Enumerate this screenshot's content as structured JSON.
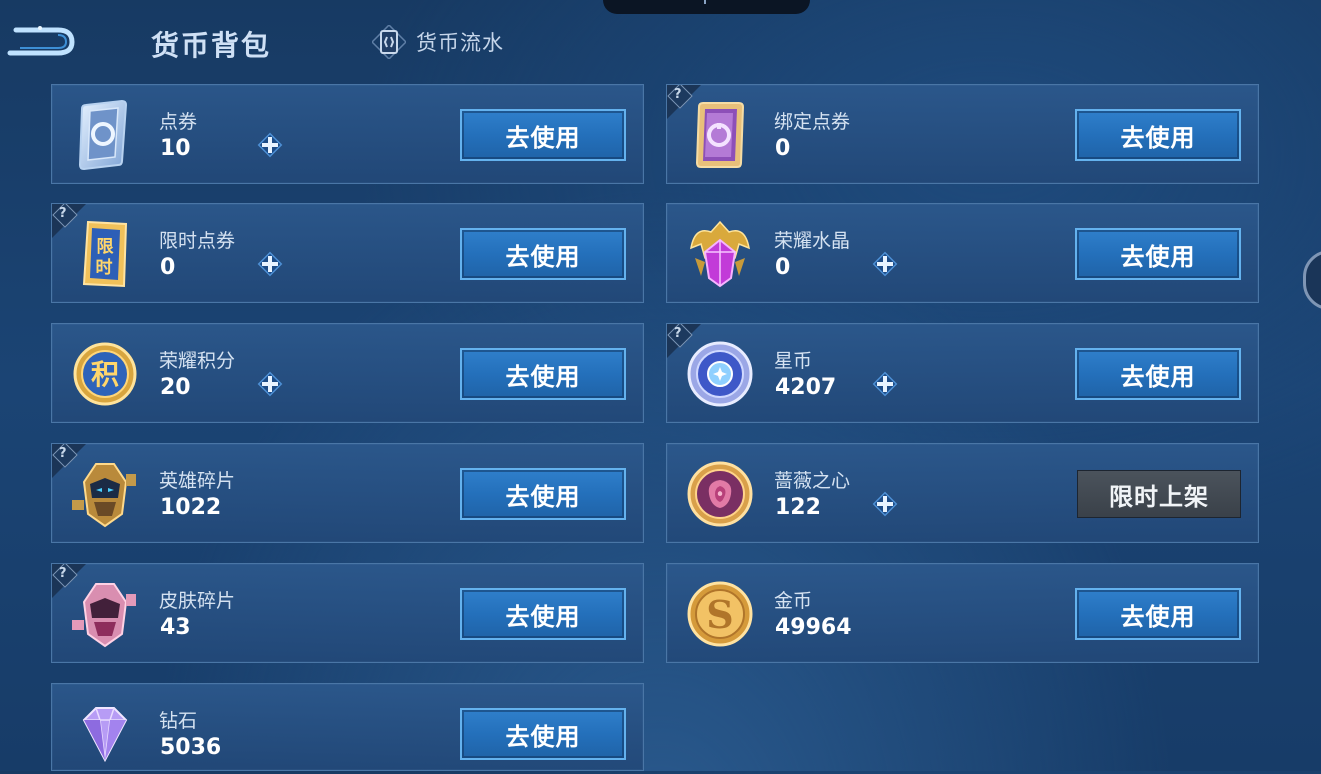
{
  "header": {
    "title": "货币背包",
    "flow_label": "货币流水",
    "back_icon": "back-arrow-icon",
    "flow_icon": "card-swap-icon"
  },
  "colors": {
    "button_blue": "#2a76c2",
    "button_border": "#64b2ee",
    "card_bg": "#2c588c",
    "disabled_button": "#444b53"
  },
  "currencies": [
    {
      "name": "点券",
      "amount": "10",
      "button": "去使用",
      "icon": "blue-coupon-icon",
      "has_plus": true,
      "has_help": false
    },
    {
      "name": "绑定点券",
      "amount": "0",
      "button": "去使用",
      "icon": "purple-coupon-icon",
      "has_plus": false,
      "has_help": true
    },
    {
      "name": "限时点券",
      "amount": "0",
      "button": "去使用",
      "icon": "limited-coupon-icon",
      "has_plus": true,
      "has_help": true
    },
    {
      "name": "荣耀水晶",
      "amount": "0",
      "button": "去使用",
      "icon": "glory-crystal-icon",
      "has_plus": true,
      "has_help": false
    },
    {
      "name": "荣耀积分",
      "amount": "20",
      "button": "去使用",
      "icon": "glory-points-icon",
      "has_plus": true,
      "has_help": false
    },
    {
      "name": "星币",
      "amount": "4207",
      "button": "去使用",
      "icon": "star-coin-icon",
      "has_plus": true,
      "has_help": true
    },
    {
      "name": "英雄碎片",
      "amount": "1022",
      "button": "去使用",
      "icon": "hero-fragment-icon",
      "has_plus": false,
      "has_help": true
    },
    {
      "name": "蔷薇之心",
      "amount": "122",
      "button": "限时上架",
      "icon": "rose-heart-icon",
      "has_plus": true,
      "has_help": false,
      "button_disabled": true
    },
    {
      "name": "皮肤碎片",
      "amount": "43",
      "button": "去使用",
      "icon": "skin-fragment-icon",
      "has_plus": false,
      "has_help": true
    },
    {
      "name": "金币",
      "amount": "49964",
      "button": "去使用",
      "icon": "gold-coin-icon",
      "has_plus": false,
      "has_help": false
    },
    {
      "name": "钻石",
      "amount": "5036",
      "button": "去使用",
      "icon": "diamond-icon",
      "has_plus": false,
      "has_help": false
    }
  ]
}
